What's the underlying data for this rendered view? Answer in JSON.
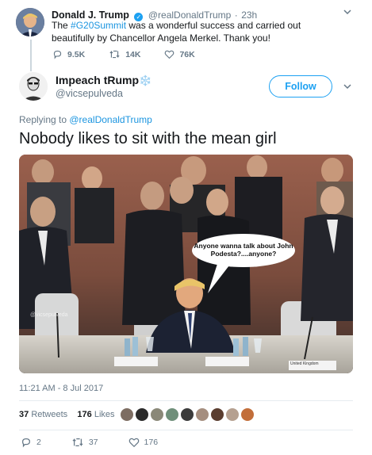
{
  "parent_tweet": {
    "name": "Donald J. Trump",
    "handle": "@realDonaldTrump",
    "separator": "·",
    "time": "23h",
    "text_before": "The ",
    "hashtag": "#G20Summit",
    "text_after": " was a wonderful success and carried out beautifully by Chancellor Angela Merkel. Thank you!",
    "replies": "9.5K",
    "retweets": "14K",
    "likes": "76K"
  },
  "tweet": {
    "name": "Impeach tRump",
    "name_emoji": "❄️",
    "handle": "@vicsepulveda",
    "follow_label": "Follow",
    "replying_prefix": "Replying to ",
    "replying_handle": "@realDonaldTrump",
    "text": "Nobody likes to sit with the mean girl",
    "image": {
      "bubble_text": "Anyone wanna talk about John Podesta?....anyone?",
      "watermark": "@vicsepulveda",
      "nameplate": "United Kingdom"
    },
    "timestamp": "11:21 AM - 8 Jul 2017",
    "retweets_count": "37",
    "retweets_label": "Retweets",
    "likes_count": "176",
    "likes_label": "Likes",
    "reply_count": "2",
    "retweet_count_action": "37",
    "like_count_action": "176"
  },
  "colors": {
    "accent": "#1da1f2",
    "link": "#1b95e0",
    "muted": "#657786"
  },
  "icons": {
    "reply": "reply-icon",
    "retweet": "retweet-icon",
    "like": "heart-icon",
    "menu": "chevron-down-icon",
    "verified": "verified-badge-icon"
  }
}
